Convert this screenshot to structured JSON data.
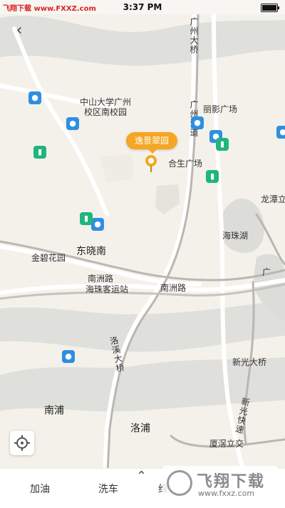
{
  "status_bar": {
    "source_tag": "飞翔下载 www.FXXZ.com",
    "time": "3:37 PM"
  },
  "map": {
    "labels": {
      "sysu": "中山大学广州\n校区南校园",
      "guangzhou_bridge_top": "广州大桥",
      "guangzhou_bridge_road": "广州大道",
      "liying": "丽影广场",
      "hesheng": "合生广场",
      "longtan": "龙潭立交",
      "haizhu_lake": "海珠湖",
      "dongxiaonan": "东晓南",
      "jinbi": "金碧花园",
      "nanzhou_road_1": "南洲路",
      "nanzhou_road_2": "南洲路",
      "haizhu_pier": "海珠客运站",
      "luoxi_bridge": "洛溪大桥",
      "xinguang_bridge": "新光大桥",
      "xinguang_expressway": "新光快速",
      "nanpu": "南浦",
      "luopu": "洛浦",
      "xiajiao": "厦滘立交",
      "edge_guang": "广"
    },
    "selected_place": "逸景翠园"
  },
  "bottom_bar": {
    "tab_fuel": "加油",
    "tab_wash": "洗车",
    "tab_partial": "维"
  },
  "watermark": {
    "title": "飞翔下载",
    "url": "www.fxxz.com"
  },
  "colors": {
    "accent": "#f5a623",
    "water": "#2f8fe0",
    "charge": "#1fb57d"
  },
  "icons": {
    "back": "chevron-left-icon",
    "locate": "crosshair-icon",
    "expand": "chevron-up-icon"
  }
}
